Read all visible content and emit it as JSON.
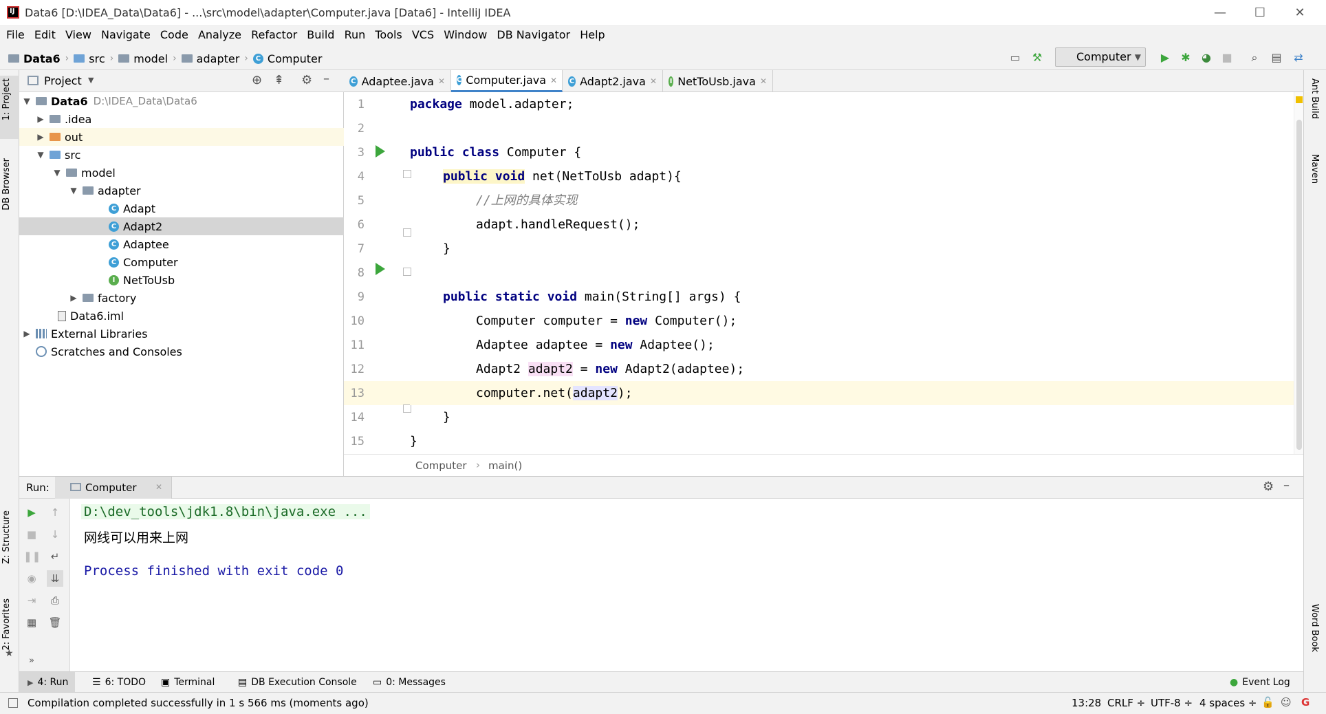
{
  "window": {
    "title": "Data6 [D:\\IDEA_Data\\Data6] - ...\\src\\model\\adapter\\Computer.java [Data6] - IntelliJ IDEA",
    "minimize": "—",
    "maximize": "☐",
    "close": "✕"
  },
  "menu": [
    "File",
    "Edit",
    "View",
    "Navigate",
    "Code",
    "Analyze",
    "Refactor",
    "Build",
    "Run",
    "Tools",
    "VCS",
    "Window",
    "DB Navigator",
    "Help"
  ],
  "breadcrumb": [
    "Data6",
    "src",
    "model",
    "adapter",
    "Computer"
  ],
  "run_config": "Computer",
  "left_tabs": {
    "project": "1: Project",
    "db_browser": "DB Browser",
    "structure": "Z: Structure",
    "favorites": "2: Favorites"
  },
  "right_tabs": {
    "ant": "Ant Build",
    "maven": "Maven",
    "wordbook": "Word Book"
  },
  "project_panel": {
    "title": "Project",
    "tree": [
      {
        "label": "Data6",
        "suffix": "D:\\IDEA_Data\\Data6",
        "icon": "folder-icon"
      },
      {
        "label": ".idea",
        "icon": "folder-icon"
      },
      {
        "label": "out",
        "icon": "folder-icon"
      },
      {
        "label": "src",
        "icon": "folder-icon"
      },
      {
        "label": "model",
        "icon": "package-icon"
      },
      {
        "label": "adapter",
        "icon": "package-icon"
      },
      {
        "label": "Adapt",
        "icon": "class-icon",
        "glyph": "C"
      },
      {
        "label": "Adapt2",
        "icon": "class-icon",
        "glyph": "C"
      },
      {
        "label": "Adaptee",
        "icon": "class-icon",
        "glyph": "C"
      },
      {
        "label": "Computer",
        "icon": "class-icon",
        "glyph": "C"
      },
      {
        "label": "NetToUsb",
        "icon": "interface-icon",
        "glyph": "I"
      },
      {
        "label": "factory",
        "icon": "package-icon"
      },
      {
        "label": "Data6.iml",
        "icon": "file-icon"
      },
      {
        "label": "External Libraries",
        "icon": "library-icon"
      },
      {
        "label": "Scratches and Consoles",
        "icon": "scratch-icon"
      }
    ]
  },
  "editor_tabs": [
    {
      "label": "Adaptee.java",
      "glyph": "C"
    },
    {
      "label": "Computer.java",
      "glyph": "C"
    },
    {
      "label": "Adapt2.java",
      "glyph": "C"
    },
    {
      "label": "NetToUsb.java",
      "glyph": "I"
    }
  ],
  "code": {
    "line_numbers": [
      "1",
      "2",
      "3",
      "4",
      "5",
      "6",
      "7",
      "8",
      "9",
      "10",
      "11",
      "12",
      "13",
      "14",
      "15"
    ],
    "l1a": "package",
    "l1b": " model.adapter;",
    "l3a": "public class",
    "l3b": " Computer {",
    "l4a": "public void",
    "l4b": " net(NetToUsb adapt){",
    "l5": "//上网的具体实现",
    "l6": "adapt.handleRequest();",
    "l7": "}",
    "l9a": "public static void",
    "l9b": " main(String[] args) {",
    "l10a": "Computer computer = ",
    "l10b": "new",
    "l10c": " Computer();",
    "l11a": "Adaptee adaptee = ",
    "l11b": "new",
    "l11c": " Adaptee();",
    "l12a": "Adapt2 ",
    "l12b": "adapt2",
    "l12c": " = ",
    "l12d": "new",
    "l12e": " Adapt2(adaptee);",
    "l13a": "computer.net(",
    "l13b": "adapt2",
    "l13c": ");",
    "l14": "}",
    "l15": "}"
  },
  "editor_breadcrumb": [
    "Computer",
    "main()"
  ],
  "run_panel": {
    "label": "Run:",
    "tab": "Computer",
    "output": [
      "D:\\dev_tools\\jdk1.8\\bin\\java.exe ...",
      "网线可以用来上网",
      "Process finished with exit code 0"
    ]
  },
  "bottom_tabs": [
    "4: Run",
    "6: TODO",
    "Terminal",
    "DB Execution Console",
    "0: Messages"
  ],
  "event_log": "Event Log",
  "status": {
    "message": "Compilation completed successfully in 1 s 566 ms (moments ago)",
    "position": "13:28",
    "line_sep": "CRLF ÷",
    "encoding": "UTF-8 ÷",
    "indent": "4 spaces ÷"
  },
  "colors": {
    "accent": "#4083c9",
    "run_green": "#3ca63c",
    "keyword": "#000080",
    "comment": "#808080",
    "caret_line": "#fffae3"
  }
}
